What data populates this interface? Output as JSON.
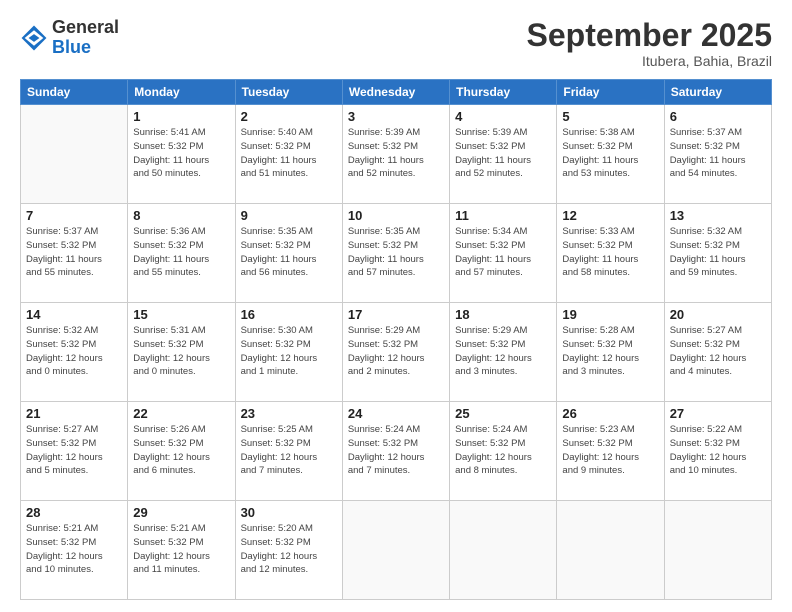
{
  "header": {
    "logo_general": "General",
    "logo_blue": "Blue",
    "month_title": "September 2025",
    "location": "Itubera, Bahia, Brazil"
  },
  "weekdays": [
    "Sunday",
    "Monday",
    "Tuesday",
    "Wednesday",
    "Thursday",
    "Friday",
    "Saturday"
  ],
  "weeks": [
    [
      {
        "day": "",
        "info": ""
      },
      {
        "day": "1",
        "info": "Sunrise: 5:41 AM\nSunset: 5:32 PM\nDaylight: 11 hours\nand 50 minutes."
      },
      {
        "day": "2",
        "info": "Sunrise: 5:40 AM\nSunset: 5:32 PM\nDaylight: 11 hours\nand 51 minutes."
      },
      {
        "day": "3",
        "info": "Sunrise: 5:39 AM\nSunset: 5:32 PM\nDaylight: 11 hours\nand 52 minutes."
      },
      {
        "day": "4",
        "info": "Sunrise: 5:39 AM\nSunset: 5:32 PM\nDaylight: 11 hours\nand 52 minutes."
      },
      {
        "day": "5",
        "info": "Sunrise: 5:38 AM\nSunset: 5:32 PM\nDaylight: 11 hours\nand 53 minutes."
      },
      {
        "day": "6",
        "info": "Sunrise: 5:37 AM\nSunset: 5:32 PM\nDaylight: 11 hours\nand 54 minutes."
      }
    ],
    [
      {
        "day": "7",
        "info": "Sunrise: 5:37 AM\nSunset: 5:32 PM\nDaylight: 11 hours\nand 55 minutes."
      },
      {
        "day": "8",
        "info": "Sunrise: 5:36 AM\nSunset: 5:32 PM\nDaylight: 11 hours\nand 55 minutes."
      },
      {
        "day": "9",
        "info": "Sunrise: 5:35 AM\nSunset: 5:32 PM\nDaylight: 11 hours\nand 56 minutes."
      },
      {
        "day": "10",
        "info": "Sunrise: 5:35 AM\nSunset: 5:32 PM\nDaylight: 11 hours\nand 57 minutes."
      },
      {
        "day": "11",
        "info": "Sunrise: 5:34 AM\nSunset: 5:32 PM\nDaylight: 11 hours\nand 57 minutes."
      },
      {
        "day": "12",
        "info": "Sunrise: 5:33 AM\nSunset: 5:32 PM\nDaylight: 11 hours\nand 58 minutes."
      },
      {
        "day": "13",
        "info": "Sunrise: 5:32 AM\nSunset: 5:32 PM\nDaylight: 11 hours\nand 59 minutes."
      }
    ],
    [
      {
        "day": "14",
        "info": "Sunrise: 5:32 AM\nSunset: 5:32 PM\nDaylight: 12 hours\nand 0 minutes."
      },
      {
        "day": "15",
        "info": "Sunrise: 5:31 AM\nSunset: 5:32 PM\nDaylight: 12 hours\nand 0 minutes."
      },
      {
        "day": "16",
        "info": "Sunrise: 5:30 AM\nSunset: 5:32 PM\nDaylight: 12 hours\nand 1 minute."
      },
      {
        "day": "17",
        "info": "Sunrise: 5:29 AM\nSunset: 5:32 PM\nDaylight: 12 hours\nand 2 minutes."
      },
      {
        "day": "18",
        "info": "Sunrise: 5:29 AM\nSunset: 5:32 PM\nDaylight: 12 hours\nand 3 minutes."
      },
      {
        "day": "19",
        "info": "Sunrise: 5:28 AM\nSunset: 5:32 PM\nDaylight: 12 hours\nand 3 minutes."
      },
      {
        "day": "20",
        "info": "Sunrise: 5:27 AM\nSunset: 5:32 PM\nDaylight: 12 hours\nand 4 minutes."
      }
    ],
    [
      {
        "day": "21",
        "info": "Sunrise: 5:27 AM\nSunset: 5:32 PM\nDaylight: 12 hours\nand 5 minutes."
      },
      {
        "day": "22",
        "info": "Sunrise: 5:26 AM\nSunset: 5:32 PM\nDaylight: 12 hours\nand 6 minutes."
      },
      {
        "day": "23",
        "info": "Sunrise: 5:25 AM\nSunset: 5:32 PM\nDaylight: 12 hours\nand 7 minutes."
      },
      {
        "day": "24",
        "info": "Sunrise: 5:24 AM\nSunset: 5:32 PM\nDaylight: 12 hours\nand 7 minutes."
      },
      {
        "day": "25",
        "info": "Sunrise: 5:24 AM\nSunset: 5:32 PM\nDaylight: 12 hours\nand 8 minutes."
      },
      {
        "day": "26",
        "info": "Sunrise: 5:23 AM\nSunset: 5:32 PM\nDaylight: 12 hours\nand 9 minutes."
      },
      {
        "day": "27",
        "info": "Sunrise: 5:22 AM\nSunset: 5:32 PM\nDaylight: 12 hours\nand 10 minutes."
      }
    ],
    [
      {
        "day": "28",
        "info": "Sunrise: 5:21 AM\nSunset: 5:32 PM\nDaylight: 12 hours\nand 10 minutes."
      },
      {
        "day": "29",
        "info": "Sunrise: 5:21 AM\nSunset: 5:32 PM\nDaylight: 12 hours\nand 11 minutes."
      },
      {
        "day": "30",
        "info": "Sunrise: 5:20 AM\nSunset: 5:32 PM\nDaylight: 12 hours\nand 12 minutes."
      },
      {
        "day": "",
        "info": ""
      },
      {
        "day": "",
        "info": ""
      },
      {
        "day": "",
        "info": ""
      },
      {
        "day": "",
        "info": ""
      }
    ]
  ]
}
